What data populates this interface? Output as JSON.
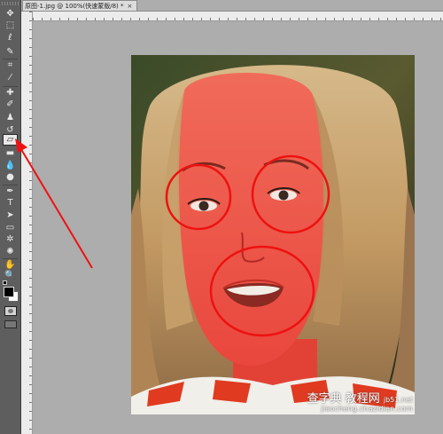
{
  "document_tab": {
    "title": "原图-1.jpg @ 100%(快速蒙版/8) *",
    "close_glyph": "×"
  },
  "toolbar": {
    "tools": [
      {
        "name": "move-tool-icon",
        "glyph": "✥"
      },
      {
        "name": "marquee-tool-icon",
        "glyph": "⬚"
      },
      {
        "name": "lasso-tool-icon",
        "glyph": "ℓ"
      },
      {
        "name": "quick-selection-tool-icon",
        "glyph": "✎"
      },
      {
        "name": "crop-tool-icon",
        "glyph": "⌗"
      },
      {
        "name": "eyedropper-tool-icon",
        "glyph": "⁄"
      },
      {
        "name": "healing-brush-tool-icon",
        "glyph": "✚"
      },
      {
        "name": "brush-tool-icon",
        "glyph": "✐"
      },
      {
        "name": "clone-stamp-tool-icon",
        "glyph": "♟"
      },
      {
        "name": "history-brush-tool-icon",
        "glyph": "↺"
      },
      {
        "name": "eraser-tool-icon",
        "glyph": "▱"
      },
      {
        "name": "gradient-tool-icon",
        "glyph": "▬"
      },
      {
        "name": "blur-tool-icon",
        "glyph": "💧"
      },
      {
        "name": "dodge-tool-icon",
        "glyph": "●"
      },
      {
        "name": "pen-tool-icon",
        "glyph": "✒"
      },
      {
        "name": "type-tool-icon",
        "glyph": "T"
      },
      {
        "name": "path-selection-tool-icon",
        "glyph": "➤"
      },
      {
        "name": "shape-tool-icon",
        "glyph": "▭"
      },
      {
        "name": "3d-rotate-tool-icon",
        "glyph": "✲"
      },
      {
        "name": "3d-orbit-tool-icon",
        "glyph": "✺"
      },
      {
        "name": "hand-tool-icon",
        "glyph": "✋"
      },
      {
        "name": "zoom-tool-icon",
        "glyph": "🔍"
      }
    ],
    "active_tool": "eraser-tool-icon"
  },
  "watermark": {
    "cn_text": "查字典 教程网",
    "url_domain": "jb51.net",
    "url_full": "jiaocheng.chazidian.com"
  },
  "colors": {
    "quick_mask_overlay": "#ff2a2a",
    "annotation": "#ee1111",
    "toolbar_bg": "#5e5e5e",
    "canvas_bg": "#adadad"
  }
}
